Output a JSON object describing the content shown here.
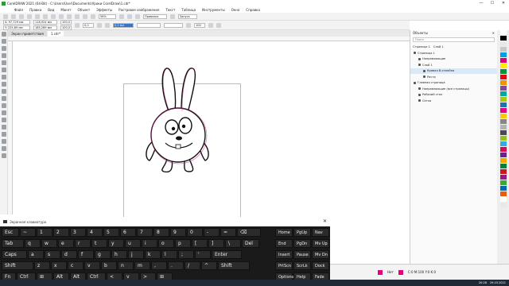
{
  "window": {
    "title": "CorelDRAW 2021 (64-Bit) - C:\\Users\\User\\Documents\\Уроки CorelDraw\\1.cdr*",
    "controls": [
      "—",
      "☐",
      "✕"
    ]
  },
  "menu": [
    "Файл",
    "Правка",
    "Вид",
    "Макет",
    "Объект",
    "Эффекты",
    "Растровое изображение",
    "Текст",
    "Таблица",
    "Инструменты",
    "Окно",
    "Справка"
  ],
  "toolbar1": {
    "zoom": "56%",
    "snap_label": "Привязка",
    "launch_label": "Запуск"
  },
  "toolbar2": {
    "x": "X: 97,729 мм",
    "y": "Y: 225,89 мм",
    "w": "118,924 мм",
    "h": "185,289 мм",
    "scale_w": "100,0",
    "scale_h": "100,0",
    "angle": "0,0",
    "outline_width": "0,2 мм",
    "opacity": "100"
  },
  "doc_tabs": [
    "Экран приветствия",
    "1.cdr*"
  ],
  "docker": {
    "title": "Объекты",
    "search_placeholder": "Поиск",
    "page_label": "Страница 1",
    "layer_label": "Слой 1",
    "rows": [
      {
        "label": "Страница 1",
        "selected": false
      },
      {
        "label": "Направляющие",
        "selected": false
      },
      {
        "label": "Слой 1",
        "selected": false
      },
      {
        "label": "Кривая В-сплайна",
        "selected": true
      },
      {
        "label": "Растр",
        "selected": false
      },
      {
        "label": "Главная страница",
        "selected": false
      },
      {
        "label": "Направляющие (все страницы)",
        "selected": false
      },
      {
        "label": "Рабочий стол",
        "selected": false
      },
      {
        "label": "Сетка",
        "selected": false
      }
    ]
  },
  "status": {
    "fill": "Нет",
    "color": "C:0 M:100 Y:0 K:0"
  },
  "taskbar": {
    "time": "20:28",
    "date": "29.03.2021"
  },
  "osk": {
    "title": "Экранная клавиатура",
    "row1": [
      "Esc",
      "~",
      "1",
      "2",
      "3",
      "4",
      "5",
      "6",
      "7",
      "8",
      "9",
      "0",
      "-",
      "=",
      "⌫",
      "Home",
      "PgUp",
      "Nav"
    ],
    "row2": [
      "Tab",
      "q",
      "w",
      "e",
      "r",
      "t",
      "y",
      "u",
      "i",
      "o",
      "p",
      "[",
      "]",
      "\\",
      "Del",
      "End",
      "PgDn",
      "Mv Up"
    ],
    "row3": [
      "Caps",
      "a",
      "s",
      "d",
      "f",
      "g",
      "h",
      "j",
      "k",
      "l",
      ";",
      "'",
      "Enter",
      "Insert",
      "Pause",
      "Mv Dn"
    ],
    "row4": [
      "Shift",
      "z",
      "x",
      "c",
      "v",
      "b",
      "n",
      "m",
      ",",
      ".",
      "/",
      "^",
      "Shift",
      "PrtScn",
      "ScrLk",
      "Dock"
    ],
    "row5": [
      "Fn",
      "Ctrl",
      "⊞",
      "Alt",
      "Alt",
      "Ctrl",
      "<",
      "v",
      ">",
      "⊞",
      "Options",
      "Help",
      "Fade"
    ]
  },
  "palette_colors": [
    "#ffffff",
    "#000000",
    "#e8e8e8",
    "#c8c8c8",
    "#00a0e0",
    "#e0007a",
    "#ffed00",
    "#00963f",
    "#e30613",
    "#f39200",
    "#7f4a9c",
    "#00a99d",
    "#a5c90f",
    "#1d71b8",
    "#e6007e",
    "#fcc900",
    "#878787",
    "#b2b2b2",
    "#4a4a4a",
    "#95c11f",
    "#36a9e1",
    "#d60b52",
    "#662483",
    "#f7a600",
    "#00843d",
    "#cd1719",
    "#951b81",
    "#3fa535",
    "#0069b4",
    "#ea5b0c",
    "#ffffff",
    "#e8e8e8"
  ]
}
